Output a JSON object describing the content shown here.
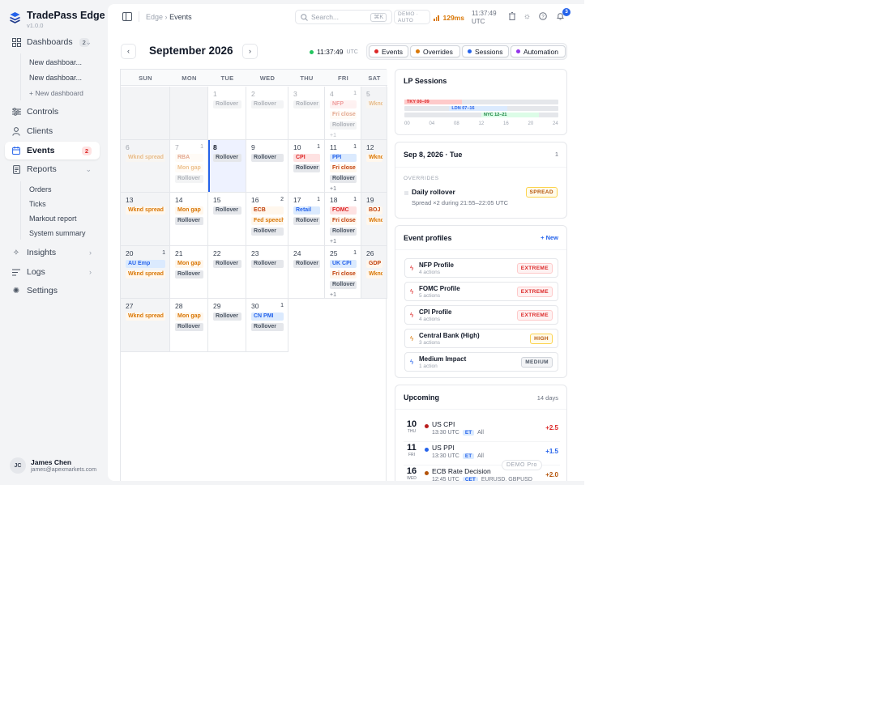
{
  "brand": {
    "name": "TradePass Edge",
    "version": "v1.0.0"
  },
  "sidebar": {
    "dashboards": {
      "label": "Dashboards",
      "count": "2"
    },
    "dashboard_items": [
      "New dashboar...",
      "New dashboar..."
    ],
    "new_dashboard": "+ New dashboard",
    "controls": "Controls",
    "clients": "Clients",
    "events": {
      "label": "Events",
      "count": "2"
    },
    "reports": "Reports",
    "report_items": [
      "Orders",
      "Ticks",
      "Markout report",
      "System summary"
    ],
    "insights": "Insights",
    "logs": "Logs",
    "settings": "Settings",
    "user": {
      "initials": "JC",
      "name": "James Chen",
      "email": "james@apexmarkets.com"
    }
  },
  "topbar": {
    "breadcrumb_root": "Edge",
    "breadcrumb_sep": "›",
    "breadcrumb_current": "Events",
    "search_placeholder": "Search...",
    "search_shortcut": "⌘K",
    "demo_line1": "DEMO ·",
    "demo_line2": "AUTO",
    "latency": "129ms",
    "time_line1": "11:37:49",
    "time_line2": "UTC",
    "notifications": "3"
  },
  "calendar": {
    "month": "September 2026",
    "prev": "‹",
    "next": "›",
    "live_time": "11:37:49",
    "live_tz": "UTC",
    "tabs": [
      {
        "label": "Events",
        "color": "#dc2626"
      },
      {
        "label": "Overrides",
        "color": "#d97706"
      },
      {
        "label": "Sessions",
        "color": "#2563eb"
      },
      {
        "label": "Automation",
        "color": "#9333ea"
      }
    ],
    "weekdays": [
      "SUN",
      "MON",
      "TUE",
      "WED",
      "THU",
      "FRI",
      "SAT"
    ],
    "weeks": [
      [
        {
          "day": "",
          "kind": "pad"
        },
        {
          "day": "",
          "kind": "pad"
        },
        {
          "day": "1",
          "faded": true,
          "chips": [
            {
              "t": "Rollover",
              "c": "gray"
            }
          ]
        },
        {
          "day": "2",
          "faded": true,
          "chips": [
            {
              "t": "Rollover",
              "c": "gray"
            }
          ]
        },
        {
          "day": "3",
          "faded": true,
          "chips": [
            {
              "t": "Rollover",
              "c": "gray"
            }
          ]
        },
        {
          "day": "4",
          "count": "1",
          "faded": true,
          "chips": [
            {
              "t": "NFP",
              "c": "red"
            },
            {
              "t": "Fri close",
              "c": "orange"
            },
            {
              "t": "Rollover",
              "c": "gray"
            },
            {
              "t": "+1",
              "c": "more"
            }
          ]
        },
        {
          "day": "5",
          "faded": true,
          "weekend": true,
          "chips": [
            {
              "t": "Wknd",
              "c": "amber"
            }
          ]
        }
      ],
      [
        {
          "day": "6",
          "faded": true,
          "weekend": true,
          "chips": [
            {
              "t": "Wknd spread",
              "c": "amber"
            }
          ]
        },
        {
          "day": "7",
          "count": "1",
          "faded": true,
          "chips": [
            {
              "t": "RBA",
              "c": "orange"
            },
            {
              "t": "Mon gap",
              "c": "amber"
            },
            {
              "t": "Rollover",
              "c": "gray"
            }
          ]
        },
        {
          "day": "8",
          "today": true,
          "chips": [
            {
              "t": "Rollover",
              "c": "gray"
            }
          ]
        },
        {
          "day": "9",
          "chips": [
            {
              "t": "Rollover",
              "c": "gray"
            }
          ]
        },
        {
          "day": "10",
          "count": "1",
          "chips": [
            {
              "t": "CPI",
              "c": "red"
            },
            {
              "t": "Rollover",
              "c": "gray"
            }
          ]
        },
        {
          "day": "11",
          "count": "1",
          "chips": [
            {
              "t": "PPI",
              "c": "blue"
            },
            {
              "t": "Fri close",
              "c": "orange"
            },
            {
              "t": "Rollover",
              "c": "gray"
            },
            {
              "t": "+1",
              "c": "more"
            }
          ]
        },
        {
          "day": "12",
          "weekend": true,
          "chips": [
            {
              "t": "Wknd",
              "c": "amber"
            }
          ]
        }
      ],
      [
        {
          "day": "13",
          "weekend": true,
          "chips": [
            {
              "t": "Wknd spread",
              "c": "amber"
            }
          ]
        },
        {
          "day": "14",
          "chips": [
            {
              "t": "Mon gap",
              "c": "amber"
            },
            {
              "t": "Rollover",
              "c": "gray"
            }
          ]
        },
        {
          "day": "15",
          "chips": [
            {
              "t": "Rollover",
              "c": "gray"
            }
          ]
        },
        {
          "day": "16",
          "count": "2",
          "chips": [
            {
              "t": "ECB",
              "c": "orange"
            },
            {
              "t": "Fed speech",
              "c": "amber"
            },
            {
              "t": "Rollover",
              "c": "gray"
            }
          ]
        },
        {
          "day": "17",
          "count": "1",
          "chips": [
            {
              "t": "Retail",
              "c": "blue"
            },
            {
              "t": "Rollover",
              "c": "gray"
            }
          ]
        },
        {
          "day": "18",
          "count": "1",
          "chips": [
            {
              "t": "FOMC",
              "c": "red"
            },
            {
              "t": "Fri close",
              "c": "orange"
            },
            {
              "t": "Rollover",
              "c": "gray"
            },
            {
              "t": "+1",
              "c": "more"
            }
          ]
        },
        {
          "day": "19",
          "weekend": true,
          "chips": [
            {
              "t": "BOJ",
              "c": "orange"
            },
            {
              "t": "Wknd",
              "c": "amber"
            }
          ]
        }
      ],
      [
        {
          "day": "20",
          "count": "1",
          "weekend": true,
          "chips": [
            {
              "t": "AU Emp",
              "c": "blue"
            },
            {
              "t": "Wknd spread",
              "c": "amber"
            }
          ]
        },
        {
          "day": "21",
          "chips": [
            {
              "t": "Mon gap",
              "c": "amber"
            },
            {
              "t": "Rollover",
              "c": "gray"
            }
          ]
        },
        {
          "day": "22",
          "chips": [
            {
              "t": "Rollover",
              "c": "gray"
            }
          ]
        },
        {
          "day": "23",
          "chips": [
            {
              "t": "Rollover",
              "c": "gray"
            }
          ]
        },
        {
          "day": "24",
          "chips": [
            {
              "t": "Rollover",
              "c": "gray"
            }
          ]
        },
        {
          "day": "25",
          "count": "1",
          "chips": [
            {
              "t": "UK CPI",
              "c": "blue"
            },
            {
              "t": "Fri close",
              "c": "orange"
            },
            {
              "t": "Rollover",
              "c": "gray"
            },
            {
              "t": "+1",
              "c": "more"
            }
          ]
        },
        {
          "day": "26",
          "weekend": true,
          "chips": [
            {
              "t": "GDP",
              "c": "orange"
            },
            {
              "t": "Wknd",
              "c": "amber"
            }
          ]
        }
      ],
      [
        {
          "day": "27",
          "weekend": true,
          "chips": [
            {
              "t": "Wknd spread",
              "c": "amber"
            }
          ]
        },
        {
          "day": "28",
          "chips": [
            {
              "t": "Mon gap",
              "c": "amber"
            },
            {
              "t": "Rollover",
              "c": "gray"
            }
          ]
        },
        {
          "day": "29",
          "chips": [
            {
              "t": "Rollover",
              "c": "gray"
            }
          ]
        },
        {
          "day": "30",
          "count": "1",
          "chips": [
            {
              "t": "CN PMI",
              "c": "blue"
            },
            {
              "t": "Rollover",
              "c": "gray"
            }
          ]
        },
        {
          "day": "",
          "kind": "empty"
        },
        {
          "day": "",
          "kind": "empty"
        },
        {
          "day": "",
          "kind": "empty"
        }
      ]
    ]
  },
  "lp_sessions": {
    "title": "LP Sessions",
    "sessions": [
      {
        "label": "TKY 00–09",
        "start": 0,
        "end": 9,
        "color": "#fecaca",
        "text": "#dc2626"
      },
      {
        "label": "LDN 07–16",
        "start": 7,
        "end": 16,
        "color": "#dbeafe",
        "text": "#2563eb"
      },
      {
        "label": "NYC 12–21",
        "start": 12,
        "end": 21,
        "color": "#dcfce7",
        "text": "#15803d"
      }
    ],
    "ticks": [
      "00",
      "04",
      "08",
      "12",
      "16",
      "20",
      "24"
    ]
  },
  "day_detail": {
    "title": "Sep 8, 2026 · Tue",
    "count": "1",
    "section": "OVERRIDES",
    "override_title": "Daily rollover",
    "override_desc": "Spread ×2 during 21:55–22:05 UTC",
    "override_tag": "SPREAD"
  },
  "profiles": {
    "title": "Event profiles",
    "new_label": "+ New",
    "items": [
      {
        "name": "NFP Profile",
        "actions": "4 actions",
        "level": "EXTREME",
        "tone": "red",
        "bolt": "#dc2626"
      },
      {
        "name": "FOMC Profile",
        "actions": "5 actions",
        "level": "EXTREME",
        "tone": "red",
        "bolt": "#dc2626"
      },
      {
        "name": "CPI Profile",
        "actions": "4 actions",
        "level": "EXTREME",
        "tone": "red",
        "bolt": "#dc2626"
      },
      {
        "name": "Central Bank (High)",
        "actions": "3 actions",
        "level": "HIGH",
        "tone": "amber",
        "bolt": "#d97706"
      },
      {
        "name": "Medium Impact",
        "actions": "1 action",
        "level": "MEDIUM",
        "tone": "gray",
        "bolt": "#2563eb"
      }
    ]
  },
  "upcoming": {
    "title": "Upcoming",
    "range": "14 days",
    "items": [
      {
        "day": "10",
        "dow": "THU",
        "dot": "#b91c1c",
        "name": "US CPI",
        "time": "13:30 UTC",
        "tz": "ET",
        "scope": "All",
        "impact": "+2.5",
        "impact_color": "#dc2626"
      },
      {
        "day": "11",
        "dow": "FRI",
        "dot": "#2563eb",
        "name": "US PPI",
        "time": "13:30 UTC",
        "tz": "ET",
        "scope": "All",
        "impact": "+1.5",
        "impact_color": "#2563eb"
      },
      {
        "day": "16",
        "dow": "WED",
        "dot": "#b45309",
        "name": "ECB Rate Decision",
        "time": "12:45 UTC",
        "tz": "CET",
        "scope": "EURUSD, GBPUSD",
        "impact": "+2.0",
        "impact_color": "#b45309"
      }
    ]
  },
  "watermark": "DEMO Pro"
}
